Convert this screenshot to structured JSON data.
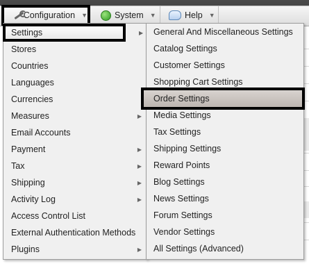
{
  "menubar": {
    "items": [
      {
        "label": "Configuration",
        "icon": "wrench-icon"
      },
      {
        "label": "System",
        "icon": "status-dot-icon"
      },
      {
        "label": "Help",
        "icon": "help-bubble-icon"
      }
    ]
  },
  "config_menu": {
    "items": [
      {
        "label": "Settings",
        "has_submenu": true,
        "highlighted": true
      },
      {
        "label": "Stores"
      },
      {
        "label": "Countries"
      },
      {
        "label": "Languages"
      },
      {
        "label": "Currencies"
      },
      {
        "label": "Measures",
        "has_submenu": true
      },
      {
        "label": "Email Accounts"
      },
      {
        "label": "Payment",
        "has_submenu": true
      },
      {
        "label": "Tax",
        "has_submenu": true
      },
      {
        "label": "Shipping",
        "has_submenu": true
      },
      {
        "label": "Activity Log",
        "has_submenu": true
      },
      {
        "label": "Access Control List"
      },
      {
        "label": "External Authentication Methods"
      },
      {
        "label": "Plugins",
        "has_submenu": true
      }
    ]
  },
  "settings_submenu": {
    "items": [
      {
        "label": "General And Miscellaneous Settings"
      },
      {
        "label": "Catalog Settings"
      },
      {
        "label": "Customer Settings"
      },
      {
        "label": "Shopping Cart Settings"
      },
      {
        "label": "Order Settings",
        "highlighted": true
      },
      {
        "label": "Media Settings"
      },
      {
        "label": "Tax Settings"
      },
      {
        "label": "Shipping Settings"
      },
      {
        "label": "Reward Points"
      },
      {
        "label": "Blog Settings"
      },
      {
        "label": "News Settings"
      },
      {
        "label": "Forum Settings"
      },
      {
        "label": "Vendor Settings"
      },
      {
        "label": "All Settings (Advanced)"
      }
    ]
  },
  "colors": {
    "menubar_dark": "#3a3a3a",
    "menu_bg": "#f0f0f0",
    "highlight_border": "#000000",
    "order_settings_highlight": "#c8c2bd",
    "system_dot": "#2e9a22"
  }
}
